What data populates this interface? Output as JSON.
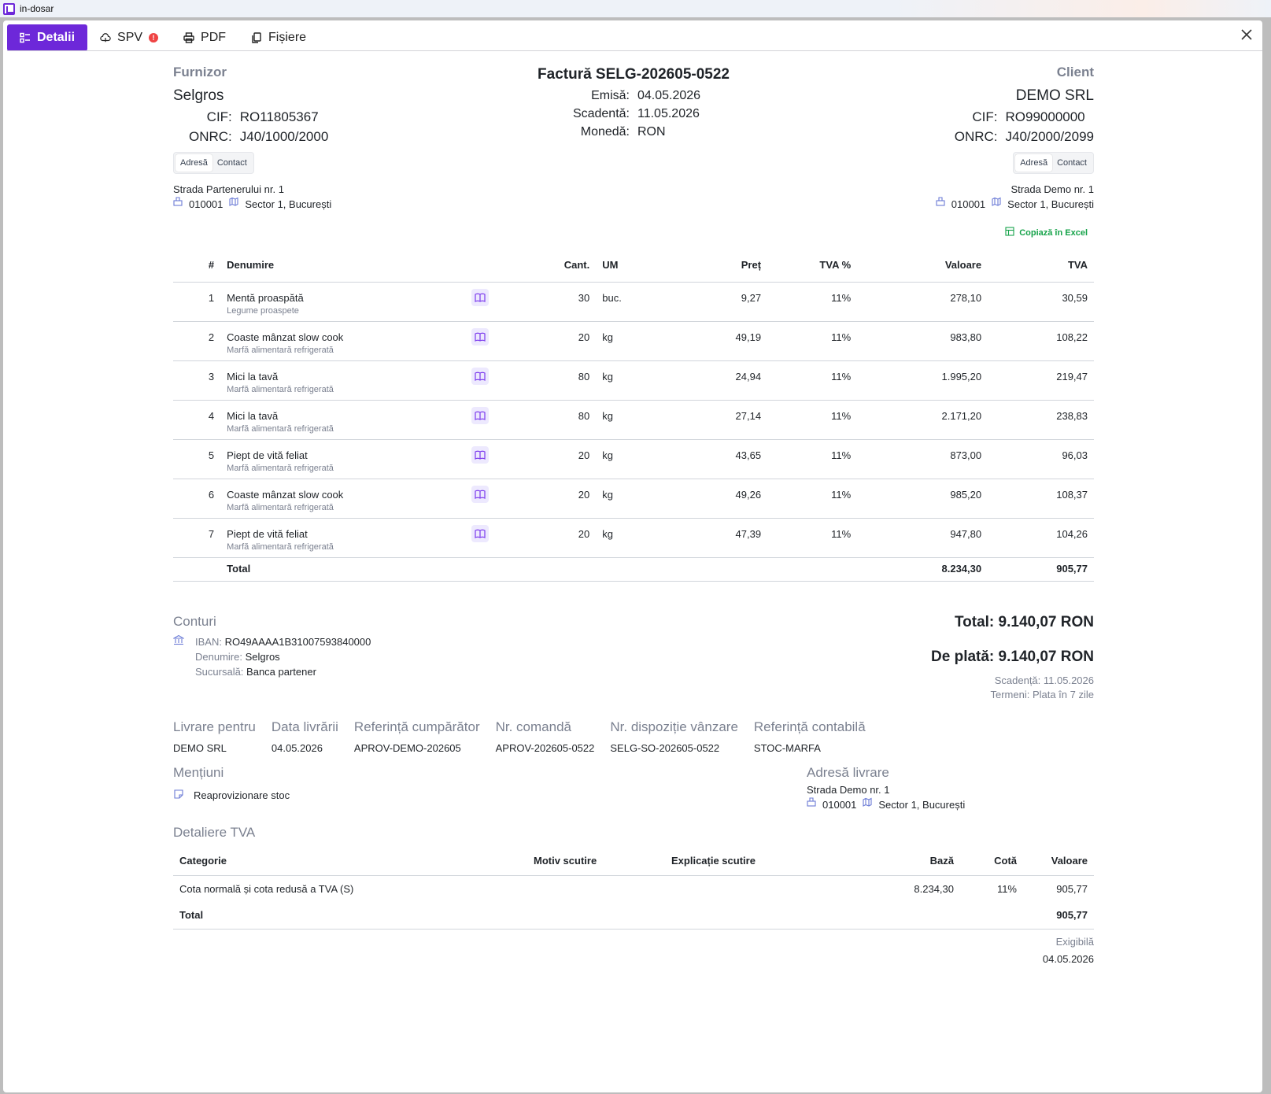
{
  "window": {
    "title": "in-dosar"
  },
  "tabs": [
    {
      "label": "Detalii"
    },
    {
      "label": "SPV",
      "badge": "!"
    },
    {
      "label": "PDF"
    },
    {
      "label": "Fișiere"
    }
  ],
  "invoice": {
    "title": "Factură SELG-202605-0522",
    "emisa_label": "Emisă:",
    "emisa": "04.05.2026",
    "scadenta_label": "Scadentă:",
    "scadenta": "11.05.2026",
    "moneda_label": "Monedă:",
    "moneda": "RON"
  },
  "furnizor": {
    "section": "Furnizor",
    "name": "Selgros",
    "cif_label": "CIF:",
    "cif": "RO11805367",
    "onrc_label": "ONRC:",
    "onrc": "J40/1000/2000",
    "seg_adresa": "Adresă",
    "seg_contact": "Contact",
    "street": "Strada Partenerului nr. 1",
    "zip": "010001",
    "city": "Sector 1, București"
  },
  "client": {
    "section": "Client",
    "name": "DEMO SRL",
    "cif_label": "CIF:",
    "cif": "RO99000000",
    "onrc_label": "ONRC:",
    "onrc": "J40/2000/2099",
    "seg_adresa": "Adresă",
    "seg_contact": "Contact",
    "street": "Strada Demo nr. 1",
    "zip": "010001",
    "city": "Sector 1, București"
  },
  "excel_link": "Copiază în Excel",
  "items_table": {
    "headers": {
      "nr": "#",
      "denumire": "Denumire",
      "cant": "Cant.",
      "um": "UM",
      "pret": "Preț",
      "tva_pct": "TVA %",
      "valoare": "Valoare",
      "tva": "TVA"
    },
    "rows": [
      {
        "nr": "1",
        "name": "Mentă proaspătă",
        "category": "Legume proaspete",
        "cant": "30",
        "um": "buc.",
        "pret": "9,27",
        "tva_pct": "11%",
        "valoare": "278,10",
        "tva": "30,59"
      },
      {
        "nr": "2",
        "name": "Coaste mânzat slow cook",
        "category": "Marfă alimentară refrigerată",
        "cant": "20",
        "um": "kg",
        "pret": "49,19",
        "tva_pct": "11%",
        "valoare": "983,80",
        "tva": "108,22"
      },
      {
        "nr": "3",
        "name": "Mici la tavă",
        "category": "Marfă alimentară refrigerată",
        "cant": "80",
        "um": "kg",
        "pret": "24,94",
        "tva_pct": "11%",
        "valoare": "1.995,20",
        "tva": "219,47"
      },
      {
        "nr": "4",
        "name": "Mici la tavă",
        "category": "Marfă alimentară refrigerată",
        "cant": "80",
        "um": "kg",
        "pret": "27,14",
        "tva_pct": "11%",
        "valoare": "2.171,20",
        "tva": "238,83"
      },
      {
        "nr": "5",
        "name": "Piept de vită feliat",
        "category": "Marfă alimentară refrigerată",
        "cant": "20",
        "um": "kg",
        "pret": "43,65",
        "tva_pct": "11%",
        "valoare": "873,00",
        "tva": "96,03"
      },
      {
        "nr": "6",
        "name": "Coaste mânzat slow cook",
        "category": "Marfă alimentară refrigerată",
        "cant": "20",
        "um": "kg",
        "pret": "49,26",
        "tva_pct": "11%",
        "valoare": "985,20",
        "tva": "108,37"
      },
      {
        "nr": "7",
        "name": "Piept de vită feliat",
        "category": "Marfă alimentară refrigerată",
        "cant": "20",
        "um": "kg",
        "pret": "47,39",
        "tva_pct": "11%",
        "valoare": "947,80",
        "tva": "104,26"
      }
    ],
    "total_label": "Total",
    "total_valoare": "8.234,30",
    "total_tva": "905,77"
  },
  "conturi": {
    "section": "Conturi",
    "iban_label": "IBAN:",
    "iban": "RO49AAAA1B31007593840000",
    "denumire_label": "Denumire:",
    "denumire": "Selgros",
    "sucursala_label": "Sucursală:",
    "sucursala": "Banca partener"
  },
  "totals": {
    "total": "Total: 9.140,07 RON",
    "de_plata": "De plată: 9.140,07 RON",
    "scadenta": "Scadență: 11.05.2026",
    "termeni": "Termeni: Plata în 7 zile"
  },
  "meta": [
    {
      "label": "Livrare pentru",
      "value": "DEMO SRL"
    },
    {
      "label": "Data livrării",
      "value": "04.05.2026"
    },
    {
      "label": "Referință cumpărător",
      "value": "APROV-DEMO-202605"
    },
    {
      "label": "Nr. comandă",
      "value": "APROV-202605-0522"
    },
    {
      "label": "Nr. dispoziție vânzare",
      "value": "SELG-SO-202605-0522"
    },
    {
      "label": "Referință contabilă",
      "value": "STOC-MARFA"
    }
  ],
  "mentiuni": {
    "section": "Mențiuni",
    "text": "Reaprovizionare stoc"
  },
  "adresa_livrare": {
    "section": "Adresă livrare",
    "street": "Strada Demo nr. 1",
    "zip": "010001",
    "city": "Sector 1, București"
  },
  "tva_detail": {
    "section": "Detaliere TVA",
    "headers": {
      "categorie": "Categorie",
      "motiv": "Motiv scutire",
      "explicatie": "Explicație scutire",
      "baza": "Bază",
      "cota": "Cotă",
      "valoare": "Valoare"
    },
    "row": {
      "categorie": "Cota normală și cota redusă a TVA (S)",
      "motiv": "",
      "explicatie": "",
      "baza": "8.234,30",
      "cota": "11%",
      "valoare": "905,77"
    },
    "total_label": "Total",
    "total_valoare": "905,77",
    "exigibila_label": "Exigibilă",
    "exigibila_date": "04.05.2026"
  },
  "colors": {
    "accent": "#6d28d9",
    "muted": "#7b8190",
    "excel": "#16a34a",
    "alert": "#ef4444"
  }
}
